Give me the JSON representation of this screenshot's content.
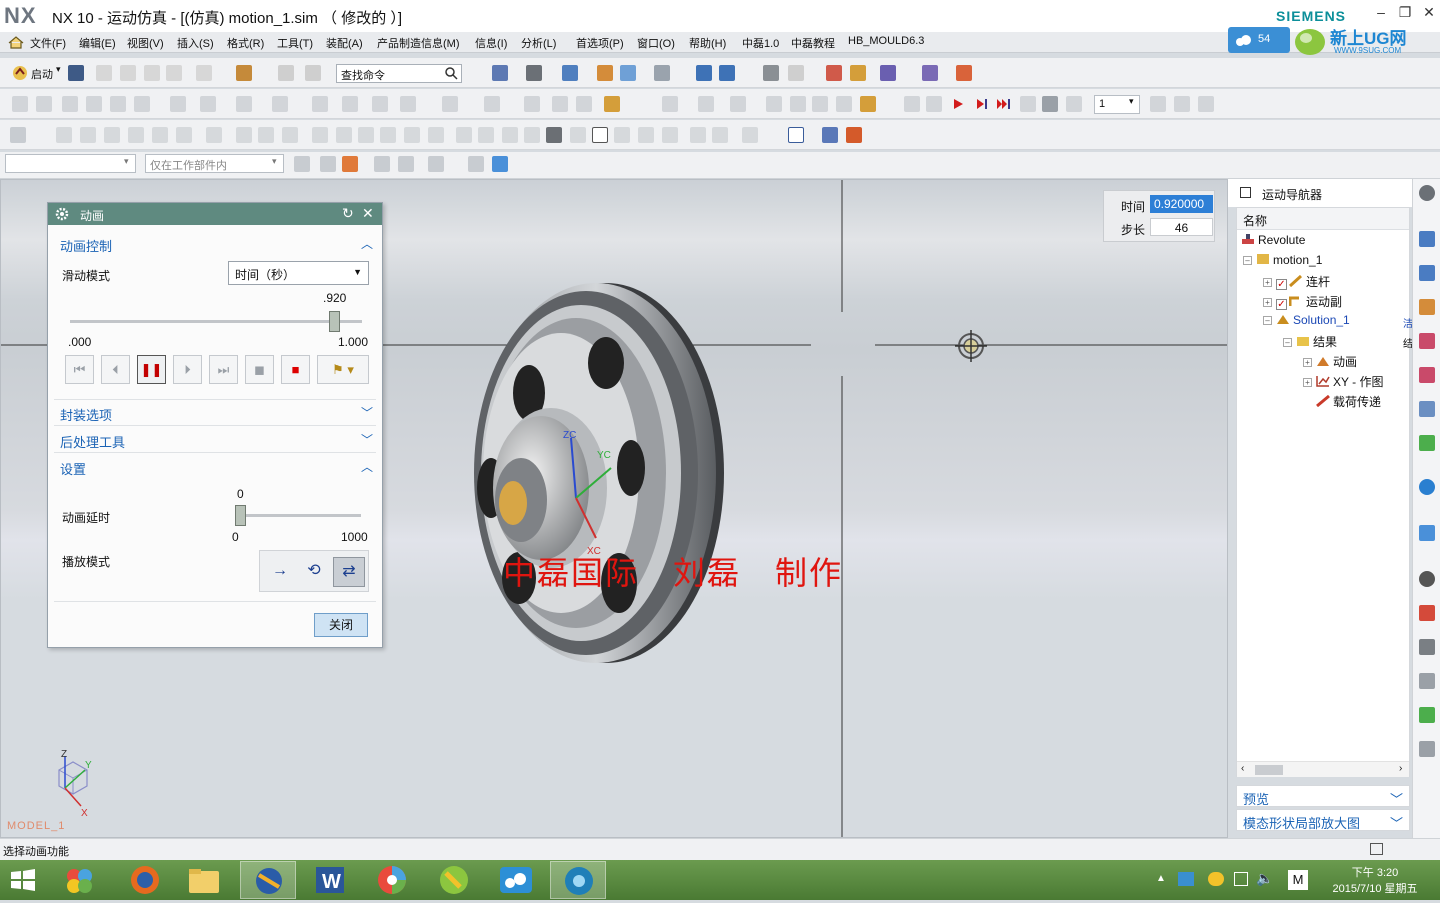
{
  "window": {
    "app_logo": "NX",
    "title": "NX 10 - 运动仿真 - [(仿真) motion_1.sim （ 修改的 ）]",
    "brand": "SIEMENS"
  },
  "menu": [
    "文件(F)",
    "编辑(E)",
    "视图(V)",
    "插入(S)",
    "格式(R)",
    "工具(T)",
    "装配(A)",
    "产品制造信息(M)",
    "信息(I)",
    "分析(L)",
    "首选项(P)",
    "窗口(O)",
    "帮助(H)",
    "中磊1.0",
    "中磊教程",
    "HB_MOULD6.3"
  ],
  "ug_badge": {
    "count": "54",
    "site_name": "新上UG网",
    "site_url": "WWW.9SUG.COM"
  },
  "toolbar": {
    "start_label": "启动",
    "find_command_placeholder": "查找命令",
    "step_value": "1"
  },
  "filterbar": {
    "selection_filter": "",
    "scope": "仅在工作部件内"
  },
  "viewport": {
    "model_label": "MODEL_1",
    "watermark": "中磊国际　刘磊　制作",
    "time_label": "时间",
    "time_value": "0.920000",
    "step_label": "步长",
    "step_value": "46",
    "axis_labels": {
      "zc": "ZC",
      "yc": "YC",
      "xc": "XC",
      "z": "Z",
      "y": "Y",
      "x": "X"
    }
  },
  "dialog": {
    "title": "动画",
    "section_control": "动画控制",
    "slide_mode_label": "滑动模式",
    "slide_mode_value": "时间（秒）",
    "slider_current": ".920",
    "slider_min": ".000",
    "slider_max": "1.000",
    "slider_fraction": 0.92,
    "section_package": "封装选项",
    "section_postprocess": "后处理工具",
    "section_settings": "设置",
    "delay_label": "动画延时",
    "delay_current": "0",
    "delay_min": "0",
    "delay_max": "1000",
    "playmode_label": "播放模式",
    "close_label": "关闭"
  },
  "navigator": {
    "title": "运动导航器",
    "column_name": "名称",
    "tree": [
      {
        "label": "Revolute",
        "level": 0
      },
      {
        "label": "motion_1",
        "level": 1
      },
      {
        "label": "连杆",
        "level": 2
      },
      {
        "label": "运动副",
        "level": 2
      },
      {
        "label": "Solution_1",
        "level": 2
      },
      {
        "label": "结果",
        "level": 3
      },
      {
        "label": "动画",
        "level": 4
      },
      {
        "label": "XY - 作图",
        "level": 4
      },
      {
        "label": "载荷传递",
        "level": 4
      }
    ],
    "col2_cut": [
      "洁",
      "结"
    ],
    "section_preview": "预览",
    "section_shape": "模态形状局部放大图"
  },
  "status": {
    "message": "选择动画功能"
  },
  "taskbar": {
    "time": "下午 3:20",
    "date": "2015/7/10 星期五",
    "ime": "M"
  },
  "colors": {
    "dialog_header": "#5f8a80",
    "section_blue": "#1b63b5",
    "watermark_red": "#e0150f",
    "time_field_bg": "#2d7fd6"
  }
}
